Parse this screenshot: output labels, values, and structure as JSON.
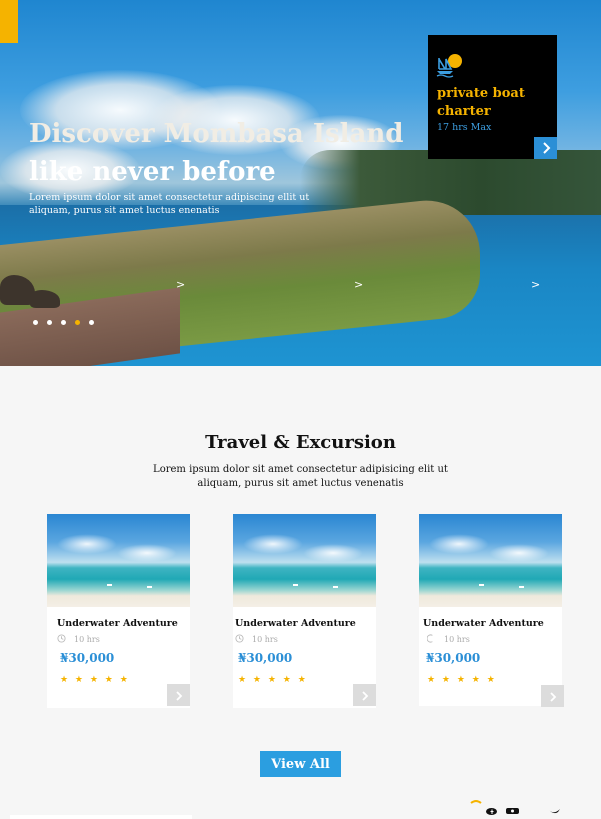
{
  "hero": {
    "title_line1": "Discover Mombasa Island",
    "title_line2": "like never before",
    "subtitle": "Lorem ipsum dolor sit amet consectetur adipiscing ellit ut aliquam, purus sit amet luctus enenatis",
    "arrow": ">",
    "slide_count": 5,
    "active_slide": 4
  },
  "promo": {
    "icon": "boat-sun-icon",
    "title": "private boat charter",
    "meta": "17 hrs Max"
  },
  "section": {
    "title": "Travel & Excursion",
    "subtitle": "Lorem ipsum dolor sit amet consectetur adipisicing elit ut aliquam, purus sit amet luctus venenatis"
  },
  "cards": [
    {
      "title": "Underwater Adventure",
      "duration": "10 hrs",
      "price": "₦30,000",
      "stars": "★ ★ ★ ★ ★"
    },
    {
      "title": "Underwater Adventure",
      "duration": "10 hrs",
      "price": "₦30,000",
      "stars": "★ ★ ★ ★ ★"
    },
    {
      "title": "Underwater Adventure",
      "duration": "10 hrs",
      "price": "₦30,000",
      "stars": "★ ★ ★ ★  ★"
    }
  ],
  "view_all": "View All",
  "colors": {
    "accent": "#f5b300",
    "primary": "#2b9ee0",
    "promo_bg": "#000000"
  },
  "social_icons": [
    "sun-icon",
    "facebook-icon",
    "youtube-icon",
    "twitter-icon"
  ]
}
